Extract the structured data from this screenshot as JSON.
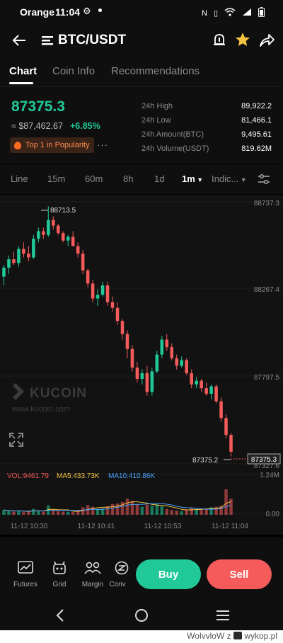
{
  "status_bar": {
    "carrier": "Orange",
    "time": "11:04",
    "battery_icon": "battery-icon",
    "wifi_icon": "wifi-icon",
    "signal_icon": "signal-icon"
  },
  "header": {
    "title": "BTC/USDT"
  },
  "tabs": [
    {
      "label": "Chart",
      "active": true
    },
    {
      "label": "Coin Info",
      "active": false
    },
    {
      "label": "Recommendations",
      "active": false
    }
  ],
  "ticker": {
    "price": "87375.3",
    "fiat": "≈ $87,462.67",
    "change": "+6.85%",
    "badge": "Top 1 in Popularity",
    "more": "···",
    "stats": [
      {
        "label": "24h High",
        "value": "89,922.2"
      },
      {
        "label": "24h Low",
        "value": "81,466.1"
      },
      {
        "label": "24h Amount(BTC)",
        "value": "9,495.61"
      },
      {
        "label": "24h Volume(USDT)",
        "value": "819.62M"
      }
    ]
  },
  "toolbar": {
    "items": [
      "Line",
      "15m",
      "60m",
      "8h",
      "1d"
    ],
    "active_interval": "1m",
    "indicators": "Indic..."
  },
  "chart": {
    "y_labels": [
      "88737.3",
      "88267.4",
      "87797.5",
      "87327.6"
    ],
    "high_marker": "88713.5",
    "low_marker": "87375.2",
    "last_price_tag": "87375.3",
    "watermark_brand": "KUCOIN",
    "watermark_url": "www.kucoin.com",
    "vol_label": "VOL:9461.79",
    "ma5_label": "MA5:433.73K",
    "ma10_label": "MA10:410.86K",
    "vol_axis_top": "1.24M",
    "vol_axis_bottom": "0.00",
    "x_labels": [
      "11-12 10:30",
      "11-12 10:41",
      "11-12 10:53",
      "11-12 11:04"
    ],
    "colors": {
      "up": "#20c997",
      "down": "#f65b5b",
      "ma5": "#f5c342",
      "ma10": "#4aa3ff"
    }
  },
  "chart_data": {
    "type": "candlestick",
    "x_labels": [
      "11-12 10:30",
      "11-12 10:41",
      "11-12 10:53",
      "11-12 11:04"
    ],
    "ylim": [
      87327.6,
      88737.3
    ],
    "candles": [
      [
        88337,
        88400,
        88290,
        88385
      ],
      [
        88385,
        88450,
        88350,
        88430
      ],
      [
        88430,
        88470,
        88400,
        88410
      ],
      [
        88410,
        88500,
        88390,
        88485
      ],
      [
        88485,
        88520,
        88440,
        88460
      ],
      [
        88460,
        88500,
        88420,
        88440
      ],
      [
        88440,
        88560,
        88430,
        88540
      ],
      [
        88540,
        88600,
        88520,
        88580
      ],
      [
        88580,
        88600,
        88540,
        88560
      ],
      [
        88560,
        88713.5,
        88550,
        88640
      ],
      [
        88640,
        88660,
        88590,
        88610
      ],
      [
        88610,
        88620,
        88560,
        88570
      ],
      [
        88570,
        88580,
        88520,
        88530
      ],
      [
        88530,
        88560,
        88500,
        88550
      ],
      [
        88550,
        88580,
        88520,
        88500
      ],
      [
        88500,
        88520,
        88440,
        88460
      ],
      [
        88460,
        88480,
        88350,
        88370
      ],
      [
        88370,
        88380,
        88280,
        88300
      ],
      [
        88300,
        88320,
        88200,
        88220
      ],
      [
        88220,
        88270,
        88180,
        88240
      ],
      [
        88240,
        88310,
        88230,
        88290
      ],
      [
        88290,
        88310,
        88180,
        88200
      ],
      [
        88200,
        88230,
        88150,
        88170
      ],
      [
        88170,
        88200,
        88080,
        88100
      ],
      [
        88100,
        88110,
        88000,
        88030
      ],
      [
        88030,
        88050,
        87900,
        87950
      ],
      [
        87950,
        87970,
        87830,
        87850
      ],
      [
        87850,
        87880,
        87770,
        87790
      ],
      [
        87790,
        87840,
        87760,
        87820
      ],
      [
        87820,
        87860,
        87700,
        87720
      ],
      [
        87720,
        87850,
        87700,
        87830
      ],
      [
        87830,
        87940,
        87820,
        87920
      ],
      [
        87920,
        88020,
        87900,
        88000
      ],
      [
        88000,
        88030,
        87940,
        87960
      ],
      [
        87960,
        87980,
        87890,
        87900
      ],
      [
        87900,
        87920,
        87840,
        87860
      ],
      [
        87860,
        87910,
        87850,
        87890
      ],
      [
        87890,
        87900,
        87810,
        87820
      ],
      [
        87820,
        87840,
        87740,
        87760
      ],
      [
        87760,
        87800,
        87740,
        87780
      ],
      [
        87780,
        87790,
        87720,
        87740
      ],
      [
        87740,
        87770,
        87700,
        87710
      ],
      [
        87710,
        87760,
        87680,
        87750
      ],
      [
        87750,
        87760,
        87660,
        87670
      ],
      [
        87670,
        87690,
        87560,
        87580
      ],
      [
        87580,
        87600,
        87470,
        87490
      ],
      [
        87490,
        87500,
        87375.2,
        87400
      ]
    ],
    "volume": [
      0.18,
      0.14,
      0.12,
      0.16,
      0.1,
      0.13,
      0.22,
      0.15,
      0.12,
      0.35,
      0.2,
      0.14,
      0.12,
      0.11,
      0.1,
      0.16,
      0.28,
      0.36,
      0.3,
      0.22,
      0.24,
      0.32,
      0.4,
      0.42,
      0.48,
      0.6,
      0.52,
      0.4,
      0.3,
      0.38,
      0.34,
      0.4,
      0.32,
      0.22,
      0.18,
      0.16,
      0.14,
      0.2,
      0.26,
      0.22,
      0.18,
      0.24,
      0.28,
      0.3,
      0.34,
      0.95,
      0.6
    ],
    "volume_ylim": [
      0,
      1.24
    ],
    "volume_unit": "M"
  },
  "bottom_bar": {
    "actions": [
      {
        "label": "Futures",
        "icon": "futures-chart-icon"
      },
      {
        "label": "Grid",
        "icon": "grid-bot-icon"
      },
      {
        "label": "Margin",
        "icon": "margin-icon"
      },
      {
        "label": "Conv",
        "icon": "convert-icon"
      }
    ],
    "buy": "Buy",
    "sell": "Sell"
  },
  "footer": {
    "user": "WolvvloW",
    "z": "z",
    "site": "wykop.pl"
  }
}
